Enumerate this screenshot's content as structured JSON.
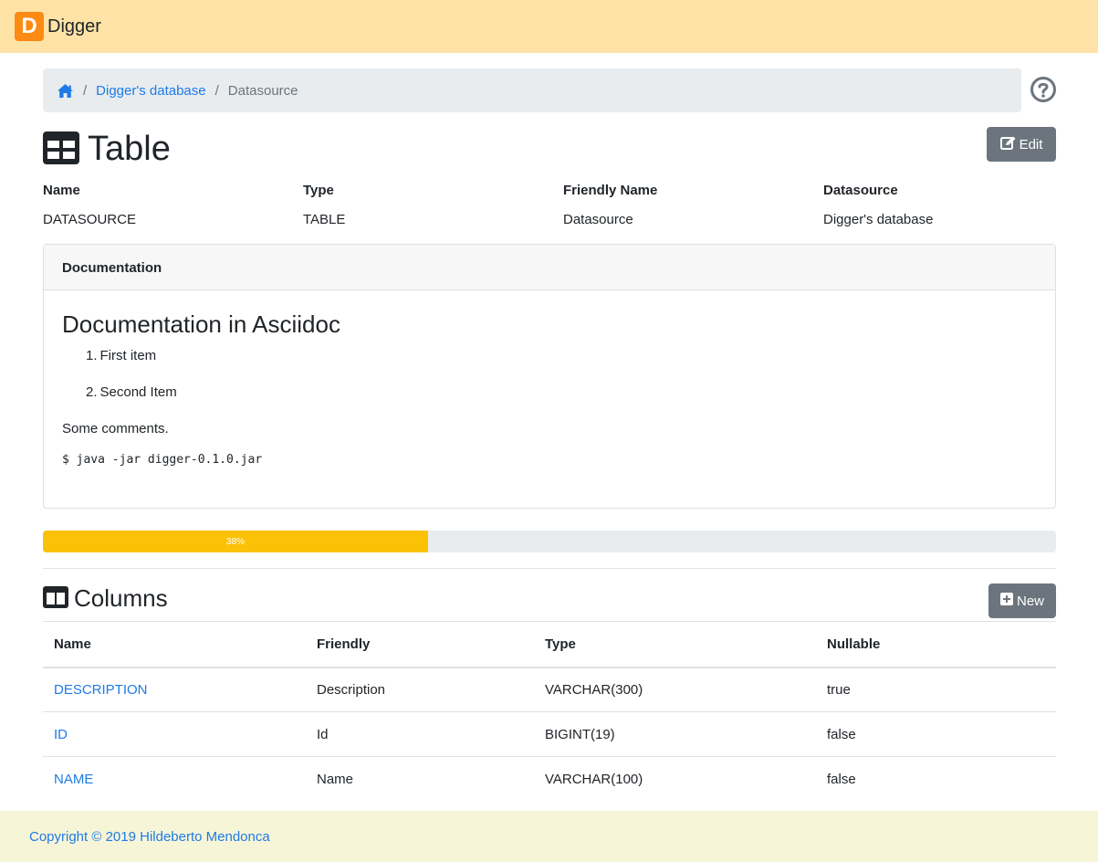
{
  "app": {
    "logo_letter": "D",
    "name": "Digger"
  },
  "breadcrumb": {
    "items": [
      "Digger's database"
    ],
    "active": "Datasource"
  },
  "page": {
    "title": "Table",
    "edit_label": "Edit"
  },
  "properties": [
    {
      "label": "Name",
      "value": "DATASOURCE"
    },
    {
      "label": "Type",
      "value": "TABLE"
    },
    {
      "label": "Friendly Name",
      "value": "Datasource"
    },
    {
      "label": "Datasource",
      "value": "Digger's database"
    }
  ],
  "documentation": {
    "header": "Documentation",
    "heading": "Documentation in Asciidoc",
    "list": [
      "First item",
      "Second Item"
    ],
    "comment": "Some comments.",
    "code": "$ java -jar digger-0.1.0.jar"
  },
  "progress": {
    "value": 38,
    "label": "38%",
    "color": "#fbc107"
  },
  "columns": {
    "title": "Columns",
    "new_label": "New",
    "headers": [
      "Name",
      "Friendly",
      "Type",
      "Nullable"
    ],
    "rows": [
      [
        "DESCRIPTION",
        "Description",
        "VARCHAR(300)",
        "true"
      ],
      [
        "ID",
        "Id",
        "BIGINT(19)",
        "false"
      ],
      [
        "NAME",
        "Name",
        "VARCHAR(100)",
        "false"
      ]
    ]
  },
  "footer": {
    "copyright": "Copyright © 2019 Hildeberto Mendonca"
  },
  "colors": {
    "navbar": "#ffe3a6",
    "brand": "#fd8a12",
    "link": "#1e7be6",
    "footer": "#f7f5d8"
  }
}
